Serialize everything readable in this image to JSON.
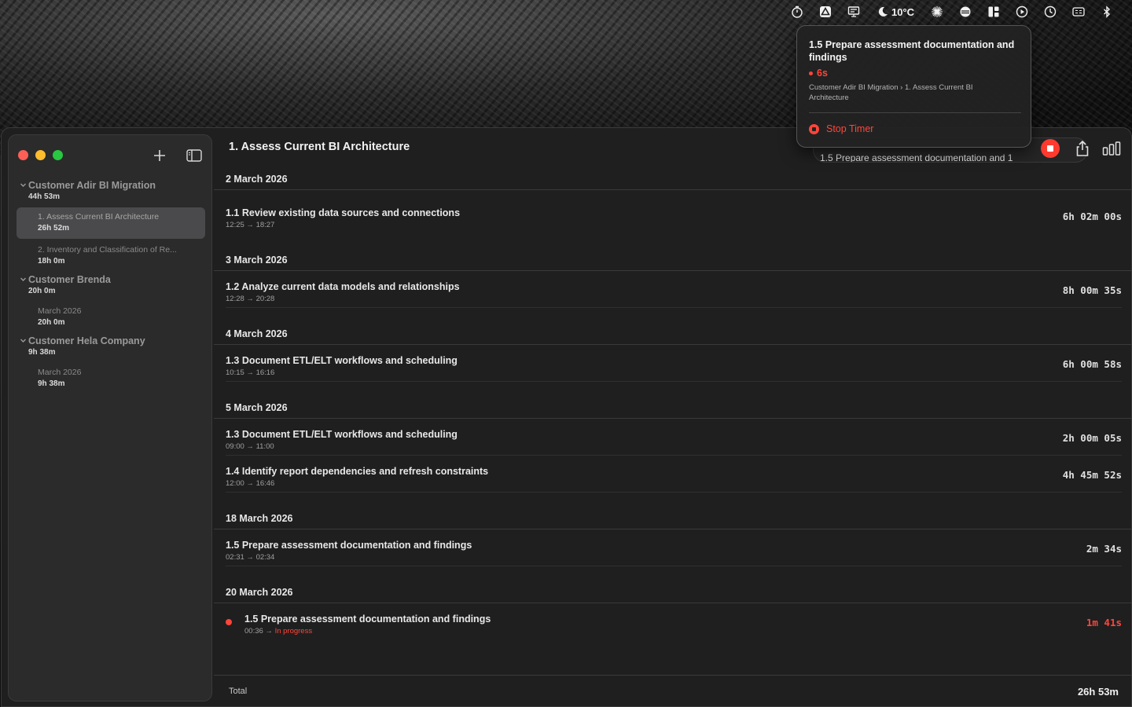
{
  "menubar": {
    "weather": "10°C",
    "icons": [
      "timer-icon",
      "drive-icon",
      "display-icon",
      "weather-moon-icon",
      "sparkle-icon",
      "menu-app-icon",
      "layout-icon",
      "play-circle-icon",
      "clock-icon",
      "cc-icon",
      "bluetooth-icon"
    ]
  },
  "popover": {
    "title": "1.5 Prepare assessment documentation and findings",
    "elapsed": "6s",
    "path": "Customer Adir BI Migration › 1. Assess Current BI Architecture",
    "stop_label": "Stop Timer"
  },
  "sidebar": {
    "groups": [
      {
        "title": "Customer Adir BI Migration",
        "time": "44h 53m",
        "items": [
          {
            "label": "1. Assess Current BI Architecture",
            "time": "26h 52m",
            "selected": true
          },
          {
            "label": "2. Inventory and Classification of Re...",
            "time": "18h 0m"
          }
        ]
      },
      {
        "title": "Customer Brenda",
        "time": "20h 0m",
        "items": [
          {
            "label": "March 2026",
            "time": "20h 0m"
          }
        ]
      },
      {
        "title": "Customer Hela Company",
        "time": "9h 38m",
        "items": [
          {
            "label": "March 2026",
            "time": "9h 38m"
          }
        ]
      }
    ]
  },
  "content": {
    "title": "1. Assess Current BI Architecture",
    "running_label": "1.5 Prepare assessment documentation and 1",
    "days": [
      {
        "date": "2 March 2026",
        "entries": [
          {
            "title": "1.1 Review existing data sources and connections",
            "start": "12:25",
            "end": "18:27",
            "duration": "6h 02m 00s"
          }
        ]
      },
      {
        "date": "3 March 2026",
        "entries": [
          {
            "title": "1.2 Analyze current data models and relationships",
            "start": "12:28",
            "end": "20:28",
            "duration": "8h 00m 35s"
          }
        ]
      },
      {
        "date": "4 March 2026",
        "entries": [
          {
            "title": "1.3 Document ETL/ELT workflows and scheduling",
            "start": "10:15",
            "end": "16:16",
            "duration": "6h 00m 58s"
          }
        ]
      },
      {
        "date": "5 March 2026",
        "entries": [
          {
            "title": "1.3 Document ETL/ELT workflows and scheduling",
            "start": "09:00",
            "end": "11:00",
            "duration": "2h 00m 05s"
          },
          {
            "title": "1.4 Identify report dependencies and refresh constraints",
            "start": "12:00",
            "end": "16:46",
            "duration": "4h 45m 52s"
          }
        ]
      },
      {
        "date": "18 March 2026",
        "entries": [
          {
            "title": "1.5 Prepare assessment documentation and findings",
            "start": "02:31",
            "end": "02:34",
            "duration": "2m 34s"
          }
        ]
      },
      {
        "date": "20 March 2026",
        "entries": [
          {
            "title": "1.5 Prepare assessment documentation and findings",
            "start": "00:36",
            "end": "In progress",
            "duration": "1m 41s",
            "running": true
          }
        ]
      }
    ],
    "arrow": "→",
    "total_label": "Total",
    "total_value": "26h 53m"
  },
  "colors": {
    "accent_red": "#ff453a",
    "window_bg": "#1f1f1f",
    "sidebar_bg": "#2b2b2c",
    "selection_bg": "#4a4a4c"
  }
}
